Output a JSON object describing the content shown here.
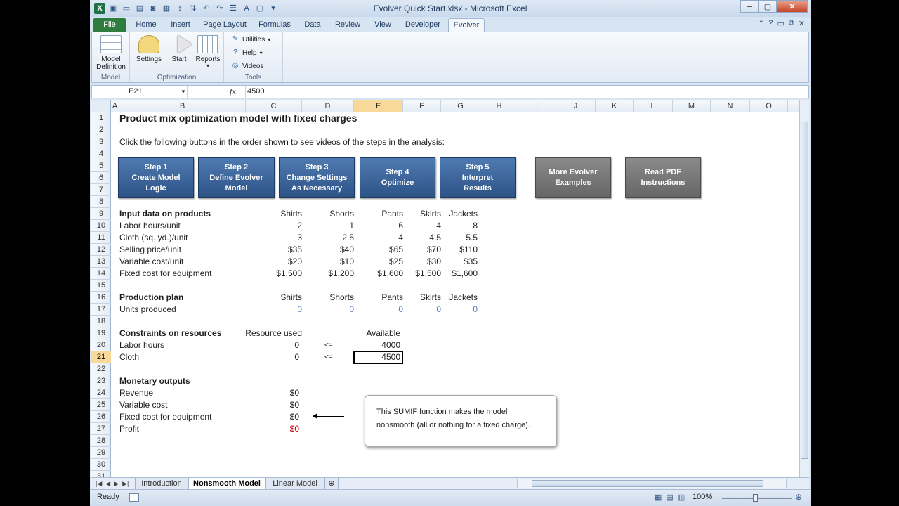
{
  "window": {
    "title": "Evolver Quick Start.xlsx  -  Microsoft Excel",
    "qat_icons": [
      "excel-icon",
      "save-icon",
      "open-icon",
      "folder-icon",
      "save-disk-icon",
      "print-preview-icon",
      "sort-icon",
      "sort-desc-icon",
      "undo-icon",
      "redo-icon",
      "list-icon",
      "font-icon",
      "box-icon",
      "customize-icon"
    ]
  },
  "tabs": [
    "File",
    "Home",
    "Insert",
    "Page Layout",
    "Formulas",
    "Data",
    "Review",
    "View",
    "Developer",
    "Evolver"
  ],
  "active_tab": "Evolver",
  "ribbon": {
    "model_group": {
      "label": "Model",
      "button": "Model\nDefinition"
    },
    "optimization_group": {
      "label": "Optimization",
      "settings": "Settings",
      "start": "Start",
      "reports": "Reports"
    },
    "tools_group": {
      "label": "Tools",
      "utilities": "Utilities",
      "help": "Help",
      "videos": "Videos"
    }
  },
  "formula_bar": {
    "name_box": "E21",
    "fx": "fx",
    "content": "4500"
  },
  "columns": [
    "A",
    "B",
    "C",
    "D",
    "E",
    "F",
    "G",
    "H",
    "I",
    "J",
    "K",
    "L",
    "M",
    "N",
    "O"
  ],
  "selected_column": "E",
  "selected_row": "21",
  "rows": [
    "1",
    "2",
    "3",
    "4",
    "5",
    "6",
    "7",
    "8",
    "9",
    "10",
    "11",
    "12",
    "13",
    "14",
    "15",
    "16",
    "17",
    "18",
    "19",
    "20",
    "21",
    "22",
    "23",
    "24",
    "25",
    "26",
    "27",
    "28",
    "29",
    "30",
    "31"
  ],
  "sheet": {
    "title": "Product mix optimization model with fixed charges",
    "instructions": "Click the following buttons in the order shown to see videos of the steps in the analysis:",
    "steps": [
      {
        "l1": "Step 1",
        "l2": "Create Model",
        "l3": "Logic"
      },
      {
        "l1": "Step 2",
        "l2": "Define Evolver",
        "l3": "Model"
      },
      {
        "l1": "Step 3",
        "l2": "Change Settings",
        "l3": "As Necessary"
      },
      {
        "l1": "Step 4",
        "l2": "Optimize",
        "l3": ""
      },
      {
        "l1": "Step 5",
        "l2": "Interpret",
        "l3": "Results"
      }
    ],
    "extra_buttons": [
      {
        "l1": "More Evolver",
        "l2": "Examples"
      },
      {
        "l1": "Read PDF",
        "l2": "Instructions"
      }
    ],
    "products": [
      "Shirts",
      "Shorts",
      "Pants",
      "Skirts",
      "Jackets"
    ],
    "input_header": "Input data on products",
    "input_rows": [
      {
        "label": "Labor hours/unit",
        "values": [
          "2",
          "1",
          "6",
          "4",
          "8"
        ]
      },
      {
        "label": "Cloth (sq. yd.)/unit",
        "values": [
          "3",
          "2.5",
          "4",
          "4.5",
          "5.5"
        ]
      },
      {
        "label": "Selling price/unit",
        "values": [
          "$35",
          "$40",
          "$65",
          "$70",
          "$110"
        ]
      },
      {
        "label": "Variable cost/unit",
        "values": [
          "$20",
          "$10",
          "$25",
          "$30",
          "$35"
        ]
      },
      {
        "label": "Fixed cost for equipment",
        "values": [
          "$1,500",
          "$1,200",
          "$1,600",
          "$1,500",
          "$1,600"
        ]
      }
    ],
    "plan_header": "Production plan",
    "units_label": "Units produced",
    "units_values": [
      "0",
      "0",
      "0",
      "0",
      "0"
    ],
    "constraints_header": "Constraints on resources",
    "resource_used_header": "Resource used",
    "available_header": "Available",
    "constraints": [
      {
        "label": "Labor hours",
        "used": "0",
        "sign": "<=",
        "available": "4000"
      },
      {
        "label": "Cloth",
        "used": "0",
        "sign": "<=",
        "available": "4500"
      }
    ],
    "monetary_header": "Monetary outputs",
    "monetary": [
      {
        "label": "Revenue",
        "value": "$0"
      },
      {
        "label": "Variable cost",
        "value": "$0"
      },
      {
        "label": "Fixed cost for equipment",
        "value": "$0"
      },
      {
        "label": "Profit",
        "value": "$0"
      }
    ],
    "callout": "This SUMIF function makes the model nonsmooth (all or nothing for a fixed charge)."
  },
  "sheet_tabs": [
    "Introduction",
    "Nonsmooth Model",
    "Linear Model"
  ],
  "active_sheet": "Nonsmooth Model",
  "status": {
    "text": "Ready",
    "zoom": "100%"
  }
}
